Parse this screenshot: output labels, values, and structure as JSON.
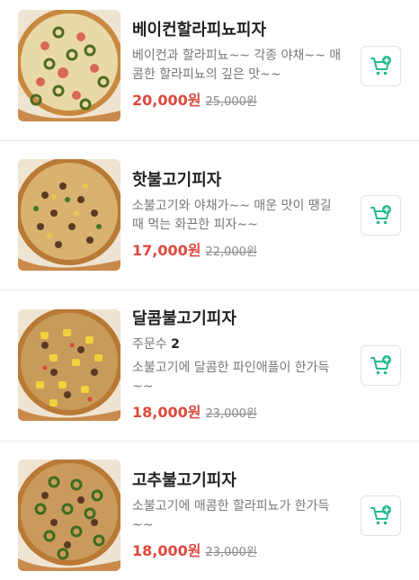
{
  "colors": {
    "price": "#e0483e",
    "cart_icon": "#25b98f",
    "title": "#222222",
    "desc": "#777777"
  },
  "menu_items": [
    {
      "name": "베이컨할라피뇨피자",
      "description": "베이컨과 할라피뇨~~ 각종 야채~~ 매콤한 할라피뇨의 깊은 맛~~",
      "price": "20,000원",
      "original_price": "25,000원",
      "image": "pizza-bacon-jalapeno",
      "cart_icon": "add-to-cart-icon"
    },
    {
      "name": "핫불고기피자",
      "description": "소불고기와 야채가~~ 매운 맛이 땡길 때 먹는 화끈한 피자~~",
      "price": "17,000원",
      "original_price": "22,000원",
      "image": "pizza-hot-bulgogi",
      "cart_icon": "add-to-cart-icon"
    },
    {
      "name": "달콤불고기피자",
      "order_label": "주문수",
      "order_count": "2",
      "description": "소불고기에 달콤한 파인애플이 한가득~~",
      "price": "18,000원",
      "original_price": "23,000원",
      "image": "pizza-sweet-bulgogi",
      "cart_icon": "add-to-cart-icon"
    },
    {
      "name": "고추불고기피자",
      "description": "소불고기에 매콤한 할라피뇨가 한가득~~",
      "price": "18,000원",
      "original_price": "23,000원",
      "image": "pizza-pepper-bulgogi",
      "cart_icon": "add-to-cart-icon"
    }
  ]
}
